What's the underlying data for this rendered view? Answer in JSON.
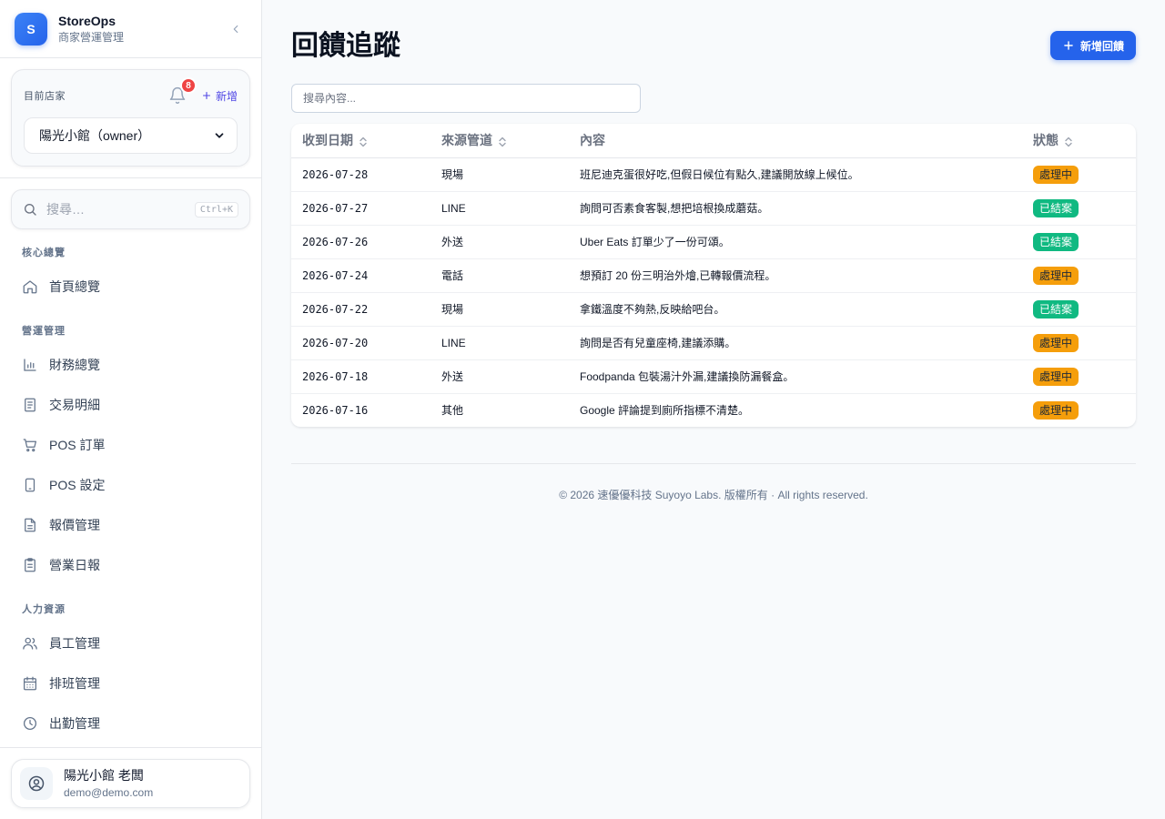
{
  "brand": {
    "logo_letter": "S",
    "name": "StoreOps",
    "subtitle": "商家營運管理"
  },
  "store": {
    "label": "目前店家",
    "notification_count": "8",
    "add_label": "新增",
    "selected": "陽光小館（owner）"
  },
  "sidebar_search": {
    "placeholder": "搜尋…",
    "shortcut": "Ctrl+K"
  },
  "nav": {
    "groups": [
      {
        "title": "核心總覽",
        "items": [
          {
            "label": "首頁總覽",
            "icon": "home-icon"
          }
        ]
      },
      {
        "title": "營運管理",
        "items": [
          {
            "label": "財務總覽",
            "icon": "bar-chart-icon"
          },
          {
            "label": "交易明細",
            "icon": "document-list-icon"
          },
          {
            "label": "POS 訂單",
            "icon": "cart-icon"
          },
          {
            "label": "POS 設定",
            "icon": "tablet-icon"
          },
          {
            "label": "報價管理",
            "icon": "file-text-icon"
          },
          {
            "label": "營業日報",
            "icon": "clipboard-icon"
          }
        ]
      },
      {
        "title": "人力資源",
        "items": [
          {
            "label": "員工管理",
            "icon": "users-icon"
          },
          {
            "label": "排班管理",
            "icon": "calendar-icon"
          },
          {
            "label": "出勤管理",
            "icon": "clock-icon"
          }
        ]
      }
    ]
  },
  "user": {
    "name": "陽光小館 老闆",
    "email": "demo@demo.com"
  },
  "page": {
    "title": "回饋追蹤",
    "add_button": "新增回饋",
    "search_placeholder": "搜尋內容..."
  },
  "table": {
    "columns": [
      "收到日期",
      "來源管道",
      "內容",
      "狀態"
    ],
    "rows": [
      {
        "date": "2026-07-28",
        "source": "現場",
        "content": "班尼迪克蛋很好吃,但假日候位有點久,建議開放線上候位。",
        "status": "處理中",
        "status_type": "processing"
      },
      {
        "date": "2026-07-27",
        "source": "LINE",
        "content": "詢問可否素食客製,想把培根換成蘑菇。",
        "status": "已結案",
        "status_type": "closed"
      },
      {
        "date": "2026-07-26",
        "source": "外送",
        "content": "Uber Eats 訂單少了一份可頌。",
        "status": "已結案",
        "status_type": "closed"
      },
      {
        "date": "2026-07-24",
        "source": "電話",
        "content": "想預訂 20 份三明治外燴,已轉報價流程。",
        "status": "處理中",
        "status_type": "processing"
      },
      {
        "date": "2026-07-22",
        "source": "現場",
        "content": "拿鐵溫度不夠熱,反映給吧台。",
        "status": "已結案",
        "status_type": "closed"
      },
      {
        "date": "2026-07-20",
        "source": "LINE",
        "content": "詢問是否有兒童座椅,建議添購。",
        "status": "處理中",
        "status_type": "processing"
      },
      {
        "date": "2026-07-18",
        "source": "外送",
        "content": "Foodpanda 包裝湯汁外漏,建議換防漏餐盒。",
        "status": "處理中",
        "status_type": "processing"
      },
      {
        "date": "2026-07-16",
        "source": "其他",
        "content": "Google 評論提到廁所指標不清楚。",
        "status": "處理中",
        "status_type": "processing"
      }
    ]
  },
  "footer": {
    "text": "© 2026 速優優科技 Suyoyo Labs. 版權所有 · All rights reserved."
  },
  "colors": {
    "primary": "#2563eb",
    "processing": "#f59e0b",
    "closed": "#10b981",
    "badge_red": "#ef4444"
  }
}
